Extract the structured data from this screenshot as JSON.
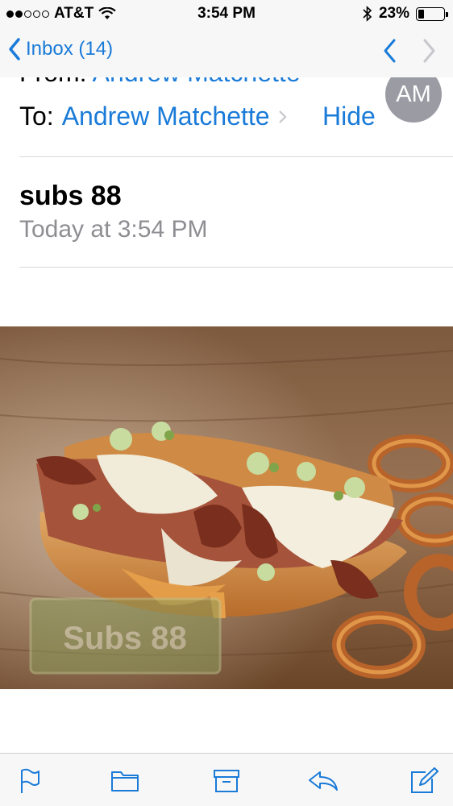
{
  "status_bar": {
    "carrier": "AT&T",
    "time": "3:54 PM",
    "battery_percent": "23%",
    "battery_level": 0.23,
    "signal_bars_filled": 2,
    "signal_bars_total": 5,
    "icons": [
      "wifi-icon",
      "bluetooth-icon",
      "battery-icon"
    ]
  },
  "nav": {
    "back_label": "Inbox (14)",
    "accent_color": "#1a7bd8"
  },
  "header": {
    "from_label": "From:",
    "from_name": "Andrew Matchette",
    "to_label": "To:",
    "to_name": "Andrew Matchette",
    "hide_label": "Hide",
    "avatar_initials": "AM"
  },
  "message": {
    "subject": "subs 88",
    "date": "Today at 3:54 PM",
    "image_watermark": "Subs 88"
  },
  "toolbar": {
    "icons": [
      "flag-icon",
      "folder-icon",
      "archive-icon",
      "reply-icon",
      "compose-icon"
    ]
  }
}
